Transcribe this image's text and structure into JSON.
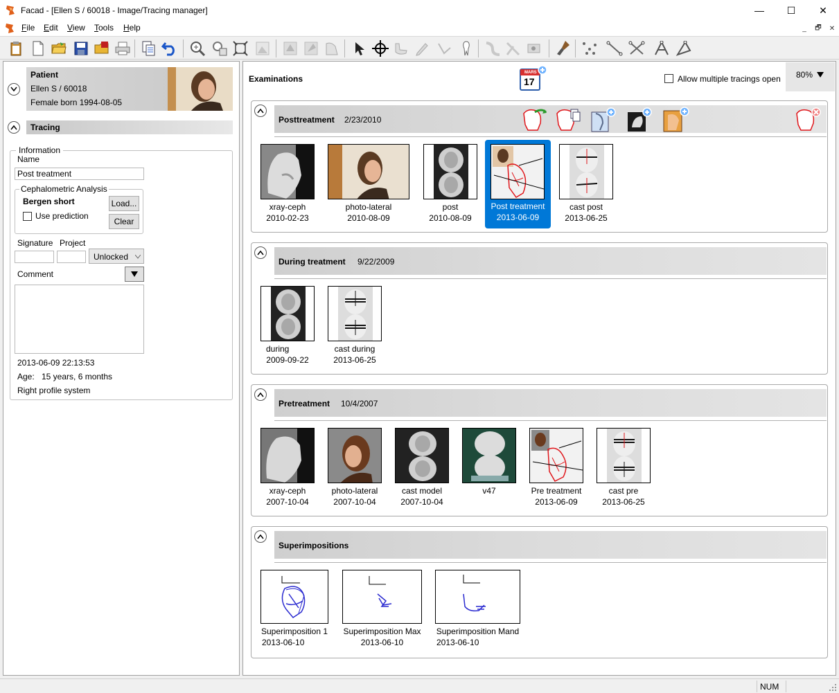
{
  "window": {
    "title": "Facad - [Ellen S / 60018 - Image/Tracing manager]",
    "min_glyph": "—",
    "max_glyph": "☐",
    "close_glyph": "✕"
  },
  "menu": {
    "file_u": "F",
    "file_rest": "ile",
    "edit_u": "E",
    "edit_rest": "dit",
    "view_u": "V",
    "view_rest": "iew",
    "tools_u": "T",
    "tools_rest": "ools",
    "help_u": "H",
    "help_rest": "elp",
    "mdi_min": "_",
    "mdi_restore": "🗗",
    "mdi_close": "✕"
  },
  "patient": {
    "header": "Patient",
    "name_id": "Ellen S / 60018",
    "born": "Female born 1994-08-05"
  },
  "tracing": {
    "header": "Tracing",
    "information_legend": "Information",
    "name_label": "Name",
    "name_value": "Post treatment",
    "ceph_legend": "Cephalometric Analysis",
    "analysis_name": "Bergen short",
    "load_label": "Load...",
    "clear_label": "Clear",
    "use_prediction_label": "Use prediction",
    "signature_label": "Signature",
    "project_label": "Project",
    "signature_value": "",
    "project_value": "",
    "lock_value": "Unlocked",
    "comment_label": "Comment",
    "comment_value": "",
    "datetime": "2013-06-09 22:13:53",
    "age_label": "Age:",
    "age_value": "15 years, 6 months",
    "profile_system": "Right profile system"
  },
  "examinations": {
    "title": "Examinations",
    "calendar_month": "MARS",
    "calendar_day": "17",
    "allow_multiple_label": "Allow multiple tracings open",
    "zoom": "80%",
    "sections": [
      {
        "title": "Posttreatment",
        "date": "2/23/2010",
        "items": [
          {
            "name": "xray-ceph",
            "date": "2010-02-23"
          },
          {
            "name": "photo-lateral",
            "date": "2010-08-09"
          },
          {
            "name": "post",
            "date": "2010-08-09"
          },
          {
            "name": "Post treatment",
            "date": "2013-06-09"
          },
          {
            "name": "cast post",
            "date": "2013-06-25"
          }
        ]
      },
      {
        "title": "During treatment",
        "date": "9/22/2009",
        "items": [
          {
            "name": "during",
            "date": "2009-09-22"
          },
          {
            "name": "cast during",
            "date": "2013-06-25"
          }
        ]
      },
      {
        "title": "Pretreatment",
        "date": "10/4/2007",
        "items": [
          {
            "name": "xray-ceph",
            "date": "2007-10-04"
          },
          {
            "name": "photo-lateral",
            "date": "2007-10-04"
          },
          {
            "name": "cast model",
            "date": "2007-10-04"
          },
          {
            "name": "v47",
            "date": ""
          },
          {
            "name": "Pre treatment",
            "date": "2013-06-09"
          },
          {
            "name": "cast pre",
            "date": "2013-06-25"
          }
        ]
      },
      {
        "title": "Superimpositions",
        "date": "",
        "items": [
          {
            "name": "Superimposition 1",
            "date": "2013-06-10"
          },
          {
            "name": "Superimposition Max",
            "date": "2013-06-10"
          },
          {
            "name": "Superimposition Mand",
            "date": "2013-06-10"
          }
        ]
      }
    ]
  },
  "status": {
    "num": "NUM"
  },
  "colors": {
    "selection": "#0078d7",
    "tracing_red": "#e0161b",
    "superimposition_blue": "#2a2ad0"
  }
}
